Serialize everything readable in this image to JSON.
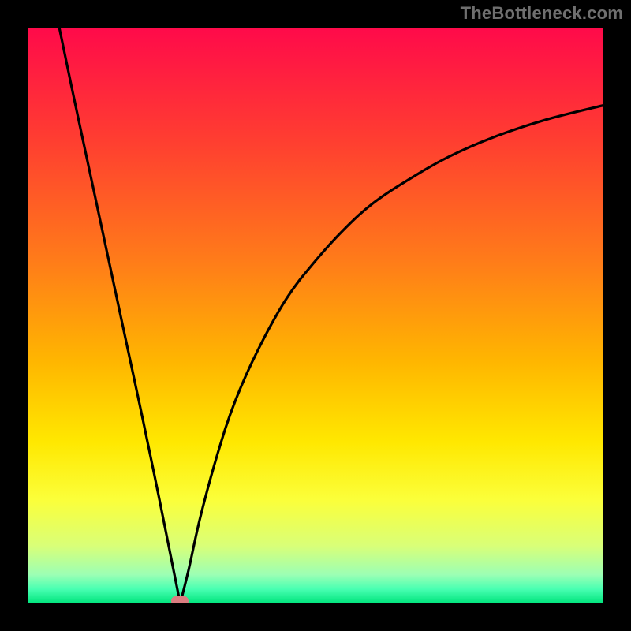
{
  "watermark": "TheBottleneck.com",
  "colors": {
    "frame": "#000000",
    "watermark": "#6f6f6f",
    "marker": "#db7d81",
    "curve": "#000000",
    "gradient_stops": [
      {
        "offset": 0.0,
        "color": "#ff0a4a"
      },
      {
        "offset": 0.2,
        "color": "#ff3f30"
      },
      {
        "offset": 0.4,
        "color": "#ff7a1a"
      },
      {
        "offset": 0.58,
        "color": "#ffb600"
      },
      {
        "offset": 0.72,
        "color": "#ffe800"
      },
      {
        "offset": 0.82,
        "color": "#fbff3a"
      },
      {
        "offset": 0.9,
        "color": "#d9ff78"
      },
      {
        "offset": 0.95,
        "color": "#9cffb4"
      },
      {
        "offset": 0.975,
        "color": "#49ffb2"
      },
      {
        "offset": 1.0,
        "color": "#00e47c"
      }
    ]
  },
  "chart_data": {
    "type": "line",
    "title": "",
    "xlabel": "",
    "ylabel": "",
    "xlim": [
      0,
      100
    ],
    "ylim": [
      0,
      100
    ],
    "grid": false,
    "legend": false,
    "min_marker": {
      "x": 26.5,
      "y": 0.4
    },
    "series": [
      {
        "name": "left-branch",
        "x": [
          5.5,
          8,
          11,
          14,
          17,
          20,
          23,
          25.5,
          26.5
        ],
        "values": [
          100,
          88,
          74,
          60,
          46,
          32,
          17.5,
          5,
          0
        ]
      },
      {
        "name": "right-branch",
        "x": [
          26.5,
          28,
          30,
          33,
          36,
          40,
          45,
          50,
          55,
          60,
          66,
          73,
          81,
          90,
          100
        ],
        "values": [
          0,
          6,
          15,
          26,
          35,
          44,
          53,
          59.5,
          65,
          69.5,
          73.5,
          77.5,
          81,
          84,
          86.5
        ]
      }
    ]
  }
}
